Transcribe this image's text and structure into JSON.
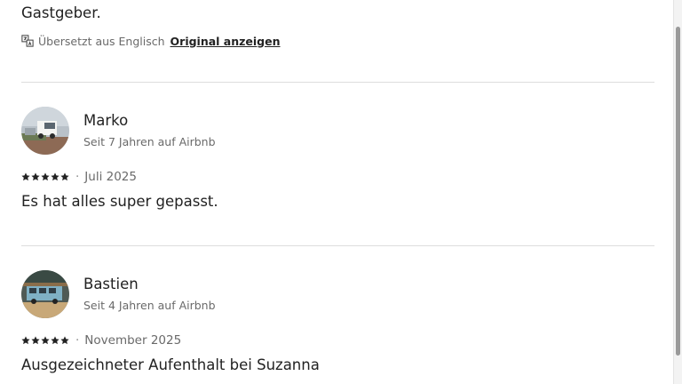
{
  "previous_review": {
    "text_tail": "Gastgeber.",
    "translation_note": "Übersetzt aus Englisch",
    "show_original_label": "Original anzeigen"
  },
  "reviews": [
    {
      "name": "Marko",
      "member_since": "Seit 7 Jahren auf Airbnb",
      "rating": 5,
      "stars": "★★★★★",
      "date": "Juli 2025",
      "text": "Es hat alles super gepasst."
    },
    {
      "name": "Bastien",
      "member_since": "Seit 4 Jahren auf Airbnb",
      "rating": 5,
      "stars": "★★★★★",
      "date": "November 2025",
      "text": "Ausgezeichneter Aufenthalt bei Suzanna"
    }
  ],
  "colors": {
    "text_primary": "#222222",
    "text_secondary": "#6a6a6a",
    "divider": "#dddddd"
  }
}
